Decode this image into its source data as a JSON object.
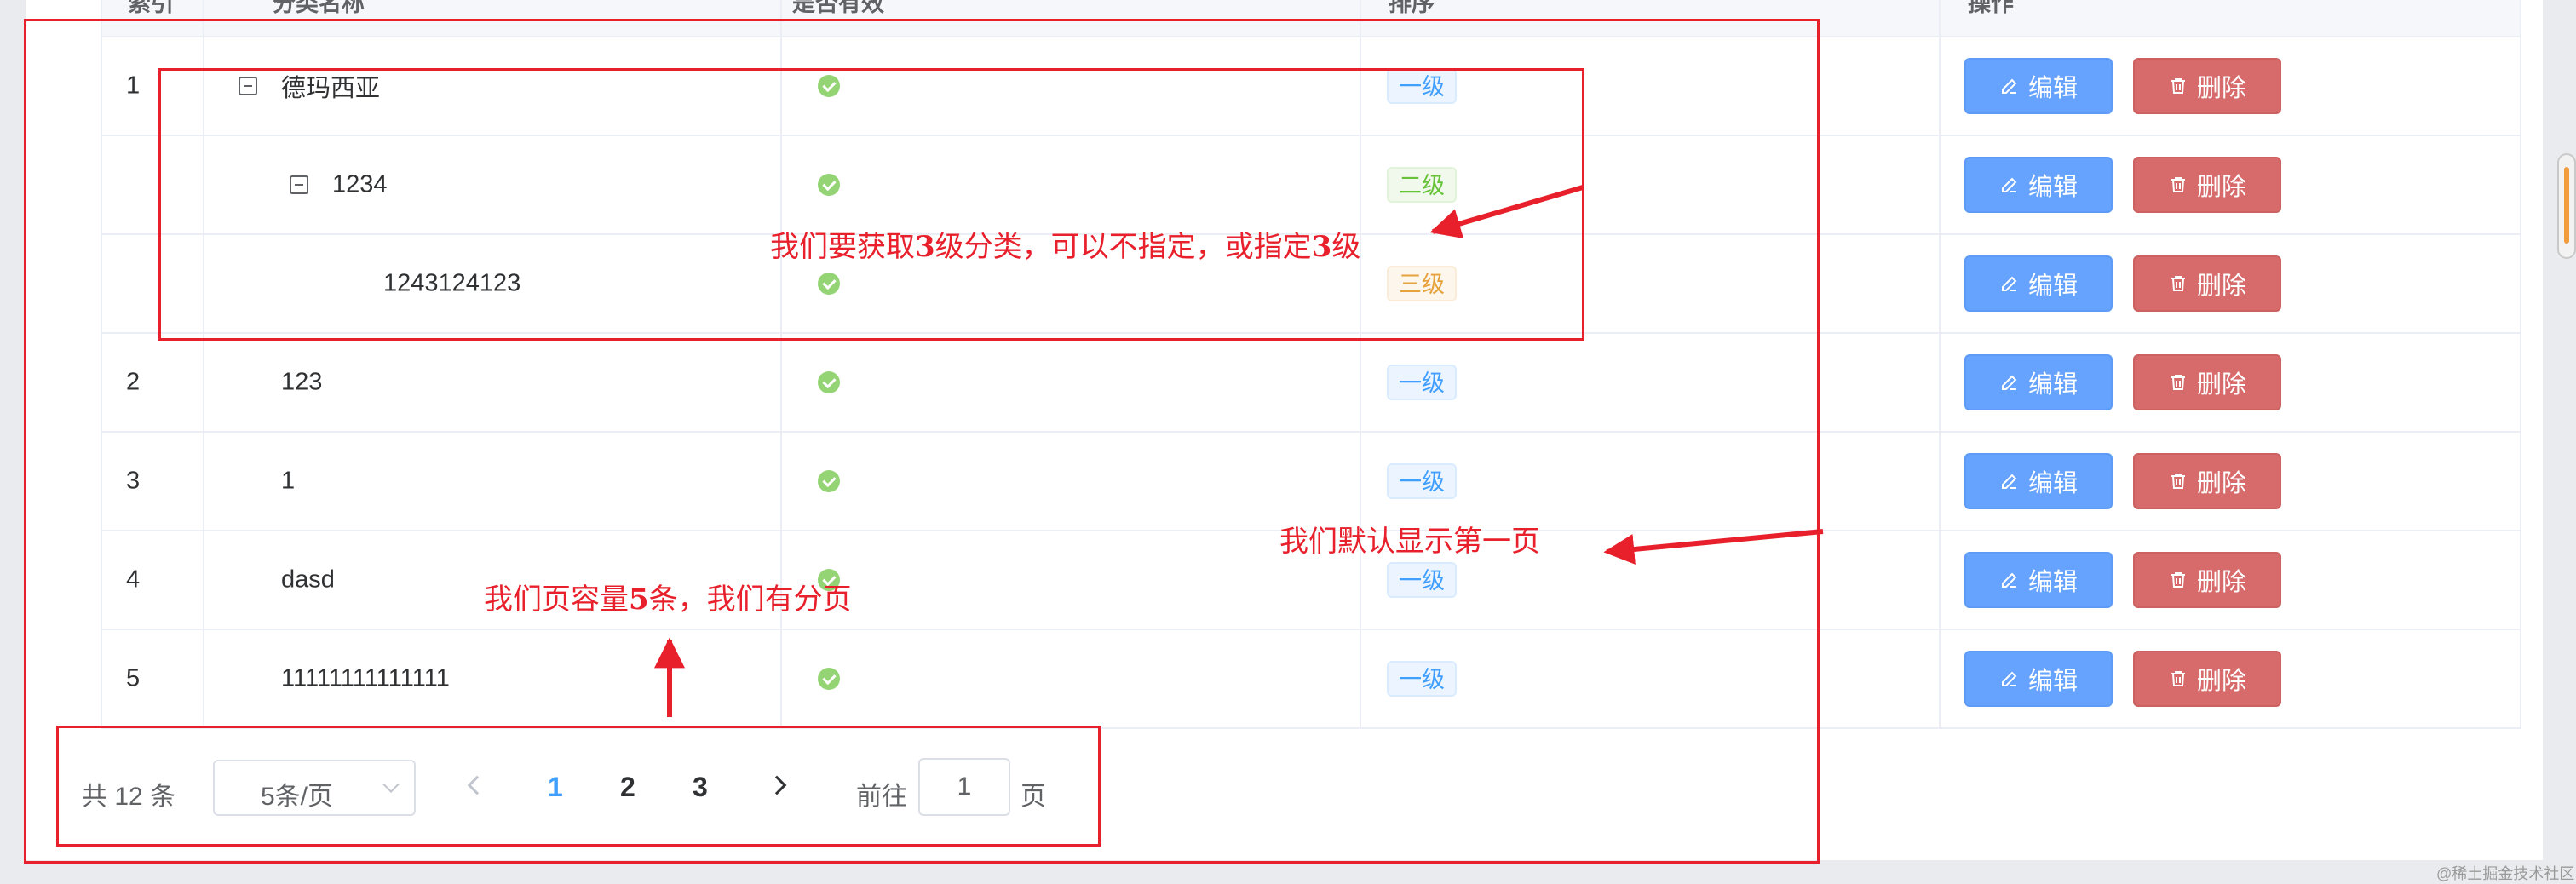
{
  "table": {
    "headers": [
      "索引",
      "分类名称",
      "是否有效",
      "排序",
      "操作"
    ],
    "rows": [
      {
        "index": "1",
        "name": "德玛西亚",
        "level": 1,
        "tree_toggle": true,
        "tag": "一级",
        "tag_type": "primary"
      },
      {
        "index": "",
        "name": "1234",
        "level": 2,
        "tree_toggle": true,
        "tag": "二级",
        "tag_type": "success"
      },
      {
        "index": "",
        "name": "1243124123",
        "level": 3,
        "tree_toggle": false,
        "tag": "三级",
        "tag_type": "warning"
      },
      {
        "index": "2",
        "name": "123",
        "level": 1,
        "tree_toggle": false,
        "tag": "一级",
        "tag_type": "primary"
      },
      {
        "index": "3",
        "name": "1",
        "level": 1,
        "tree_toggle": false,
        "tag": "一级",
        "tag_type": "primary"
      },
      {
        "index": "4",
        "name": "dasd",
        "level": 1,
        "tree_toggle": false,
        "tag": "一级",
        "tag_type": "primary"
      },
      {
        "index": "5",
        "name": "11111111111111",
        "level": 1,
        "tree_toggle": false,
        "tag": "一级",
        "tag_type": "primary"
      }
    ],
    "edit_label": "编辑",
    "delete_label": "删除",
    "valid_icon": "check-circle-icon"
  },
  "pagination": {
    "total_text": "共 12 条",
    "page_size": "5条/页",
    "pages": [
      "1",
      "2",
      "3"
    ],
    "current_page": "1",
    "goto_label": "前往",
    "goto_value": "1",
    "goto_suffix": "页"
  },
  "annotations": {
    "level3": "我们要获取3级分类，可以不指定，或指定3级",
    "first_page": "我们默认显示第一页",
    "page_size": "我们页容量5条，我们有分页"
  },
  "watermark": "@稀土掘金技术社区",
  "colors": {
    "primary": "#409eff",
    "edit_button": "#66a3ff",
    "delete_button": "#d76b6b",
    "annotation": "#e8202b",
    "valid": "#95d475"
  }
}
